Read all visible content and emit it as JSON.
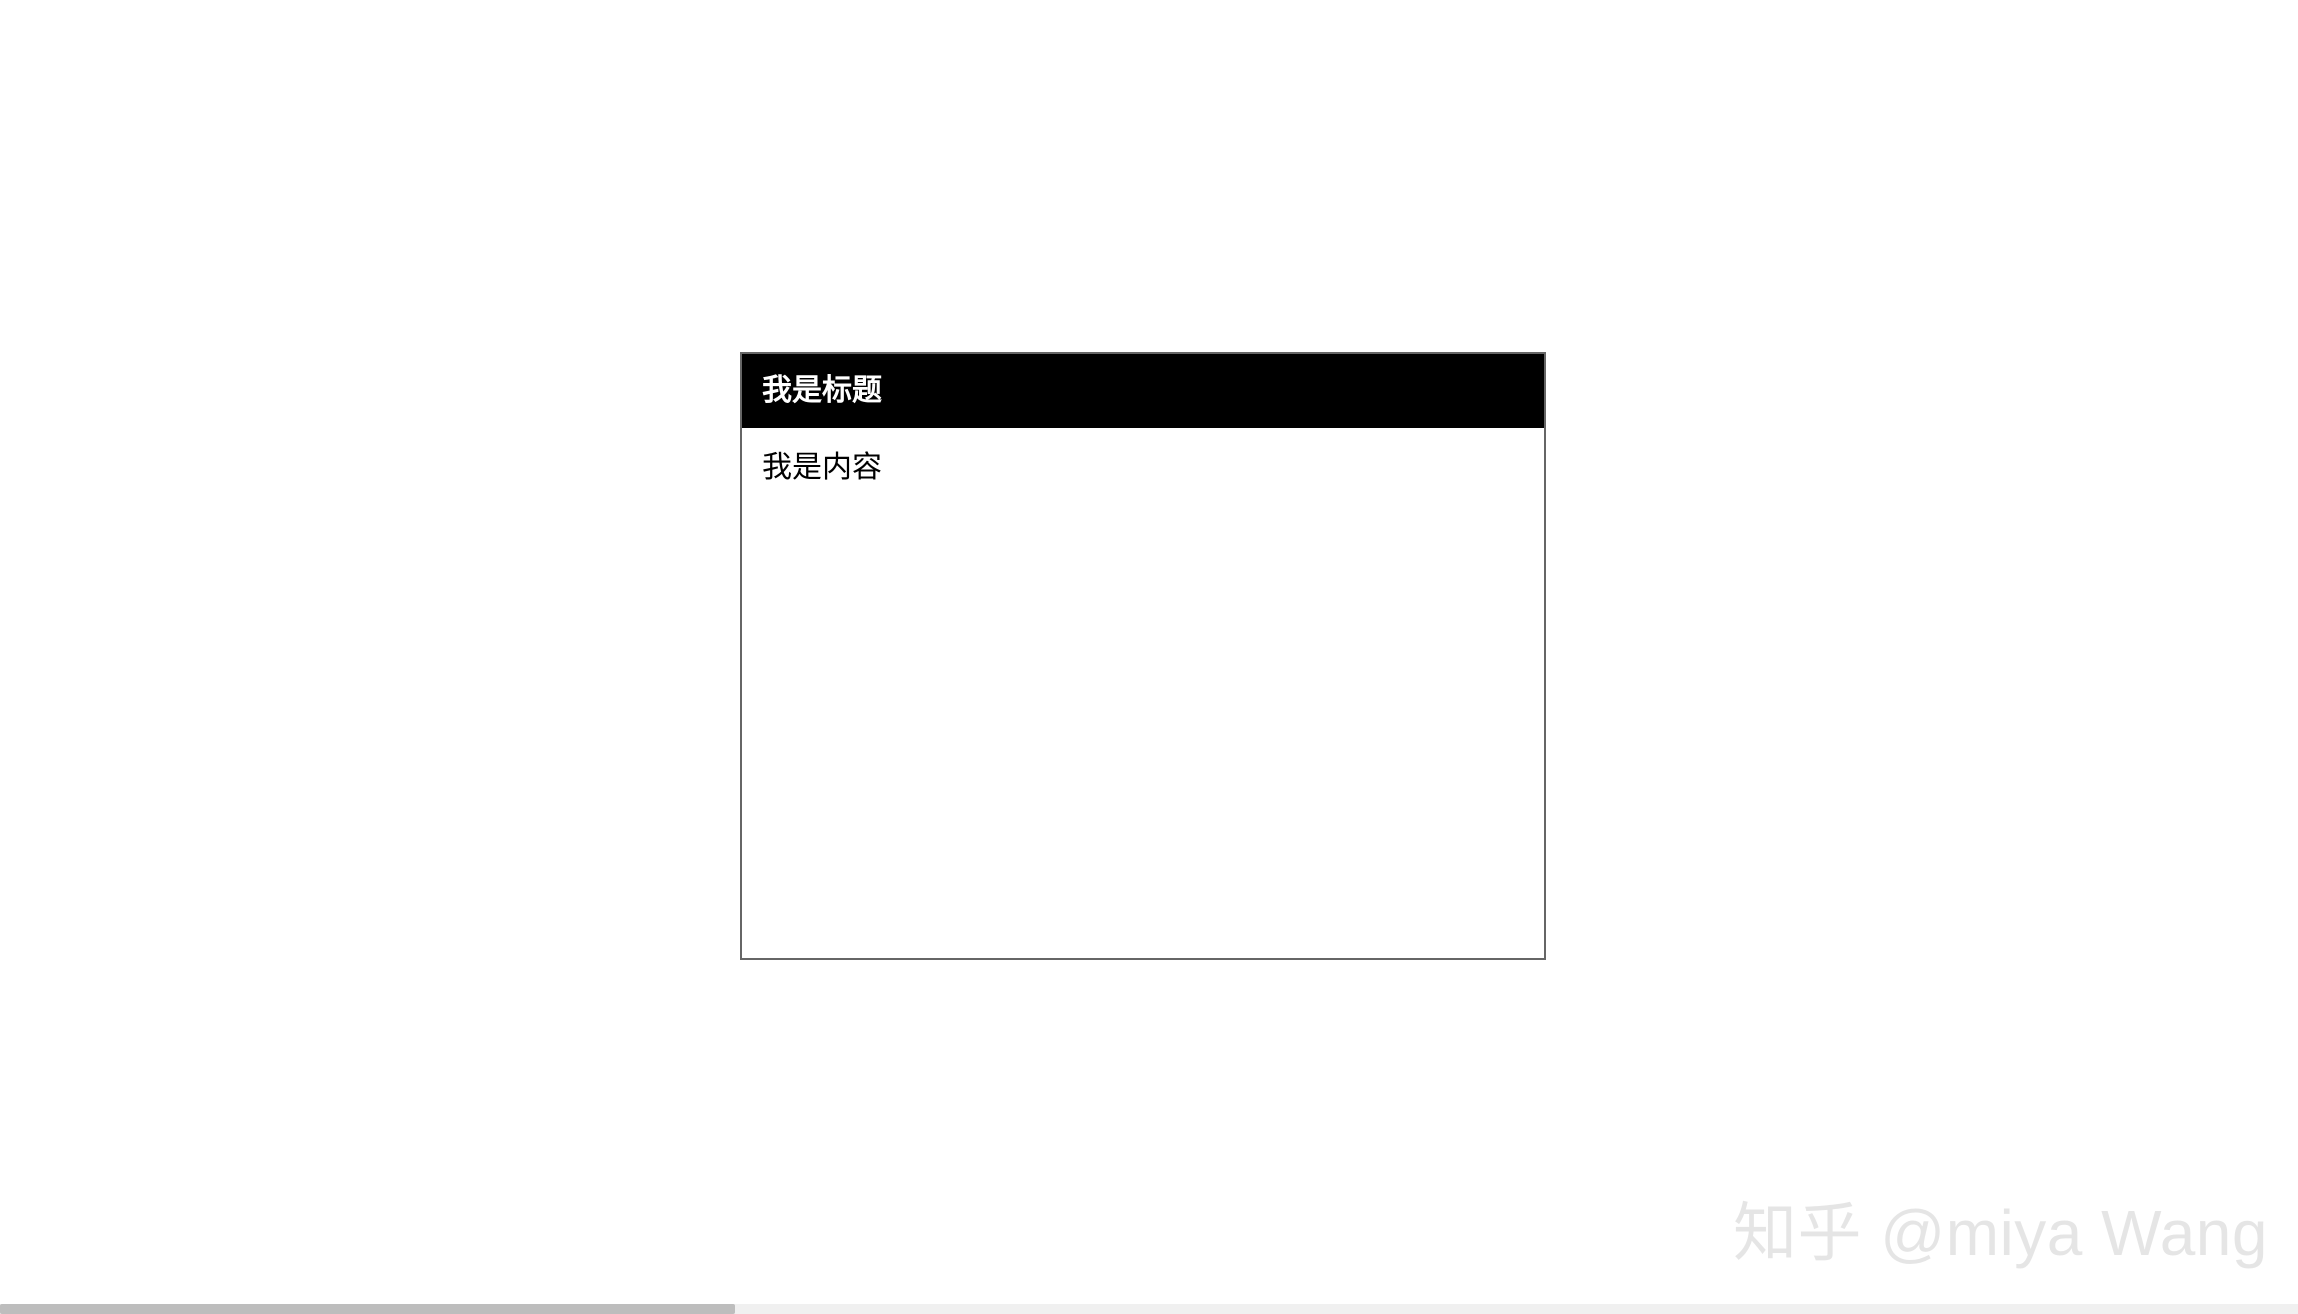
{
  "panel": {
    "title": "我是标题",
    "content": "我是内容"
  },
  "watermark": "知乎 @miya Wang"
}
